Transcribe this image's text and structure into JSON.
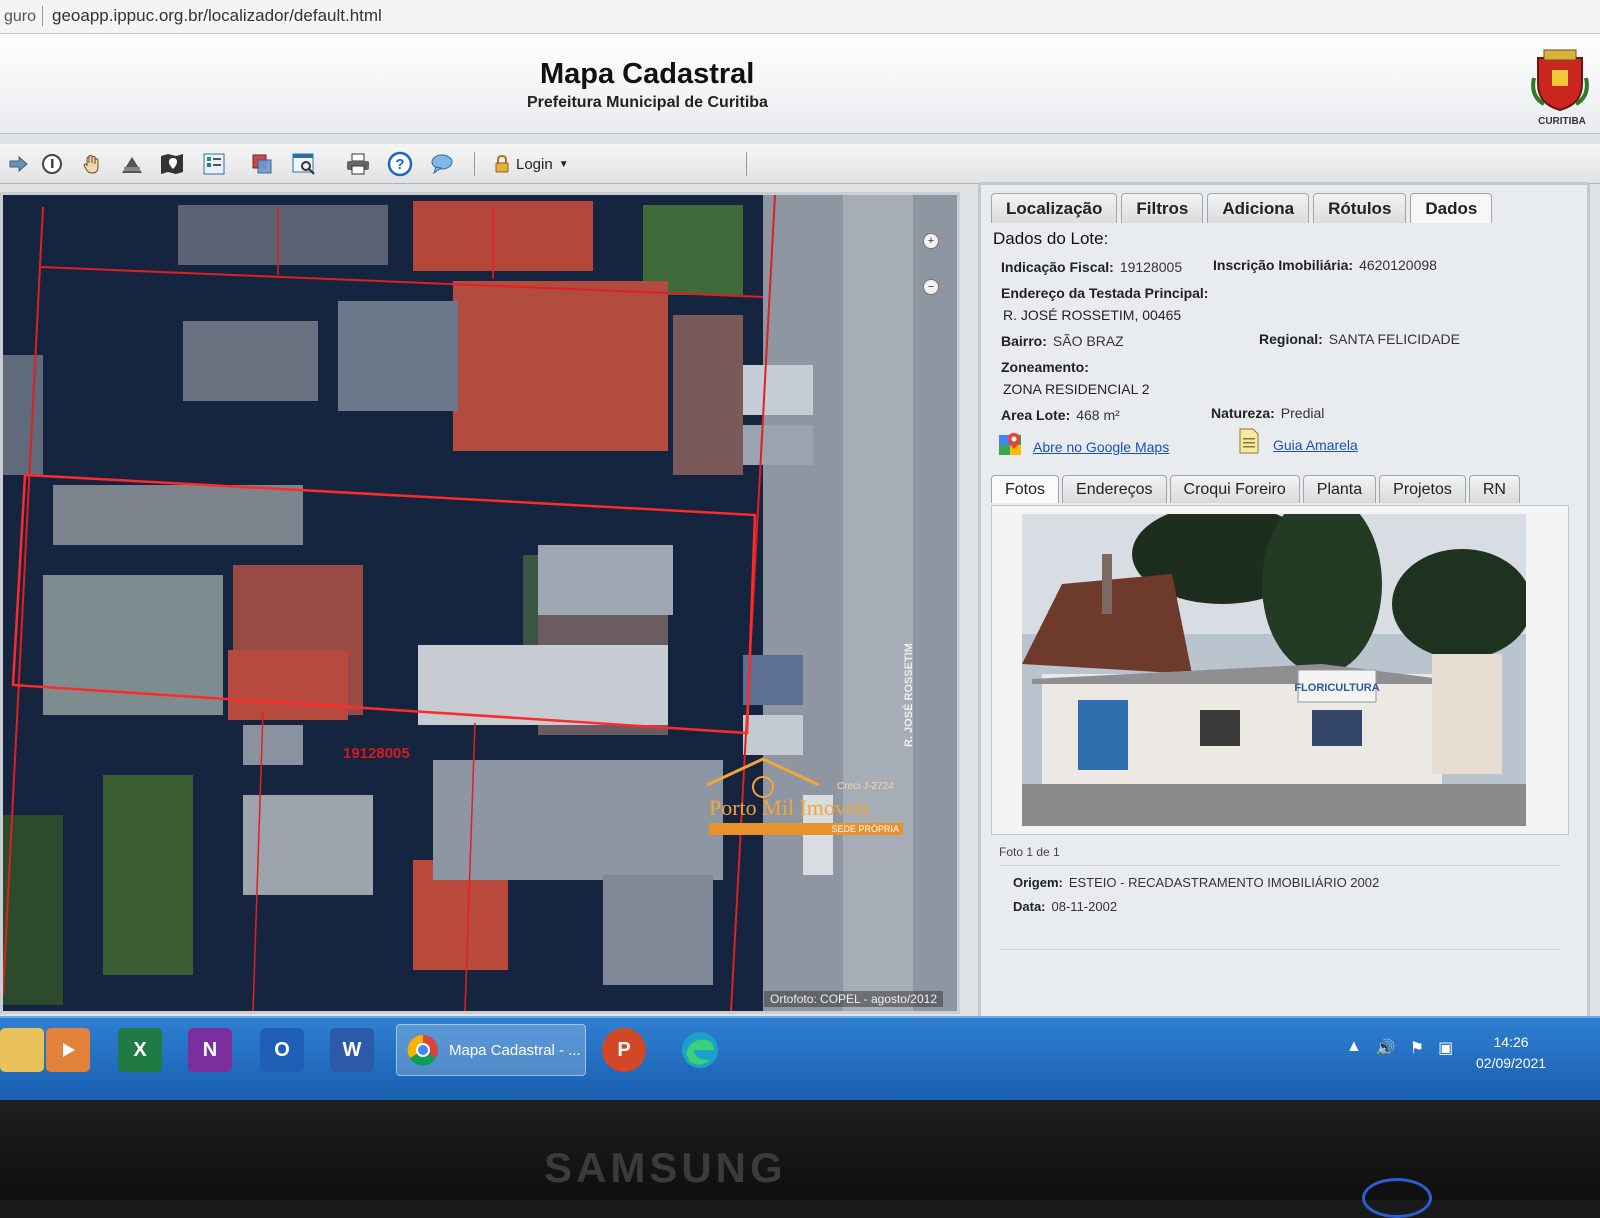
{
  "browser": {
    "security_text": "guro",
    "url": "geoapp.ippuc.org.br/localizador/default.html"
  },
  "header": {
    "title": "Mapa Cadastral",
    "subtitle": "Prefeitura Municipal de Curitiba",
    "crest_label": "CURITIBA"
  },
  "toolbar": {
    "login_label": "Login",
    "icons": [
      "forward-icon",
      "info-icon",
      "pan-hand-icon",
      "measure-icon",
      "map-layers-icon",
      "legend-icon",
      "overlay-icon",
      "search-window-icon",
      "print-icon",
      "help-icon",
      "chat-icon",
      "lock-icon"
    ]
  },
  "map": {
    "lot_label": "19128005",
    "street_label": "R. JOSÉ ROSSETIM",
    "credit": "Ortofoto: COPEL - agosto/2012",
    "watermark": {
      "brand": "Porto Mil Imoveis",
      "creci": "Creci J-2724",
      "tag": "SEDE PRÓPRIA"
    }
  },
  "panel": {
    "tabs": [
      {
        "label": "Localização"
      },
      {
        "label": "Filtros"
      },
      {
        "label": "Adiciona"
      },
      {
        "label": "Rótulos"
      },
      {
        "label": "Dados"
      }
    ],
    "section_title": "Dados do Lote:",
    "fields": {
      "indicacao_label": "Indicação Fiscal:",
      "indicacao_value": "19128005",
      "inscricao_label": "Inscrição Imobiliária:",
      "inscricao_value": "4620120098",
      "endereco_label": "Endereço da Testada Principal:",
      "endereco_value": "R. JOSÉ ROSSETIM, 00465",
      "bairro_label": "Bairro:",
      "bairro_value": "SÃO BRAZ",
      "regional_label": "Regional:",
      "regional_value": "SANTA FELICIDADE",
      "zoneamento_label": "Zoneamento:",
      "zoneamento_value": "ZONA RESIDENCIAL 2",
      "area_label": "Area Lote:",
      "area_value": "468 m²",
      "natureza_label": "Natureza:",
      "natureza_value": "Predial"
    },
    "links": {
      "google_maps": "Abre no Google Maps",
      "guia_amarela": "Guia Amarela"
    },
    "subtabs": [
      {
        "label": "Fotos"
      },
      {
        "label": "Endereços"
      },
      {
        "label": "Croqui Foreiro"
      },
      {
        "label": "Planta"
      },
      {
        "label": "Projetos"
      },
      {
        "label": "RN"
      }
    ],
    "photo": {
      "sign_text": "FLORICULTURA",
      "count": "Foto 1 de 1",
      "origem_label": "Origem:",
      "origem_value": "ESTEIO - RECADASTRAMENTO IMOBILIÁRIO 2002",
      "data_label": "Data:",
      "data_value": "08-11-2002"
    }
  },
  "taskbar": {
    "apps": [
      {
        "name": "file-explorer-icon",
        "letter": ""
      },
      {
        "name": "media-player-icon",
        "letter": ""
      },
      {
        "name": "excel-icon",
        "letter": "X"
      },
      {
        "name": "onenote-icon",
        "letter": "N"
      },
      {
        "name": "outlook-icon",
        "letter": "O"
      },
      {
        "name": "word-icon",
        "letter": "W"
      }
    ],
    "active_window": "Mapa Cadastral - ...",
    "powerpoint_letter": "P",
    "time": "14:26",
    "date": "02/09/2021"
  },
  "monitor": {
    "brand": "SAMSUNG"
  },
  "colors": {
    "accent_blue": "#1a4fbf",
    "lot_border": "#e02020",
    "taskbar": "#2a72c4"
  }
}
